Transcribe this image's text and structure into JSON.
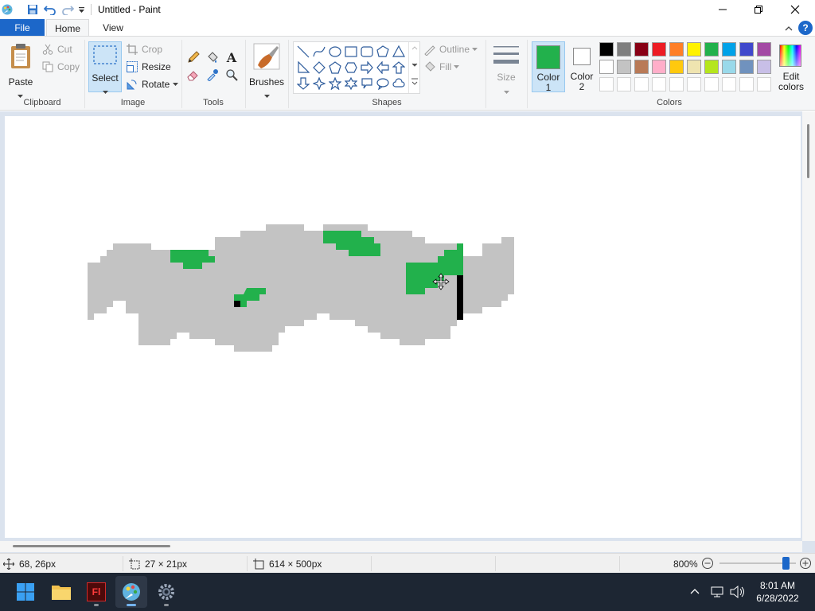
{
  "window": {
    "title": "Untitled - Paint"
  },
  "tabs": {
    "file": "File",
    "home": "Home",
    "view": "View"
  },
  "clipboard": {
    "paste": "Paste",
    "cut": "Cut",
    "copy": "Copy",
    "label": "Clipboard"
  },
  "image": {
    "select": "Select",
    "crop": "Crop",
    "resize": "Resize",
    "rotate": "Rotate",
    "label": "Image"
  },
  "tools": {
    "label": "Tools"
  },
  "brushes": {
    "label": "Brushes"
  },
  "shapes": {
    "outline": "Outline",
    "fill": "Fill",
    "label": "Shapes"
  },
  "size": {
    "label": "Size"
  },
  "colors": {
    "color1_line1": "Color",
    "color1_line2": "1",
    "color2_line1": "Color",
    "color2_line2": "2",
    "edit_line1": "Edit",
    "edit_line2": "colors",
    "label": "Colors",
    "color1_value": "#22b14c",
    "color2_value": "#ffffff",
    "palette_row1": [
      "#000000",
      "#7f7f7f",
      "#880015",
      "#ed1c24",
      "#ff7f27",
      "#fff200",
      "#22b14c",
      "#00a2e8",
      "#3f48cc",
      "#a349a4"
    ],
    "palette_row2": [
      "#ffffff",
      "#c3c3c3",
      "#b97a57",
      "#ffaec9",
      "#ffc90e",
      "#efe4b0",
      "#b5e61d",
      "#99d9ea",
      "#7092be",
      "#c8bfe7"
    ]
  },
  "status": {
    "cursor_pos": "68, 26px",
    "selection_size": "27 × 21px",
    "canvas_size": "614 × 500px",
    "zoom": "800%"
  },
  "taskbar": {
    "time": "8:01 AM",
    "date": "6/28/2022"
  }
}
